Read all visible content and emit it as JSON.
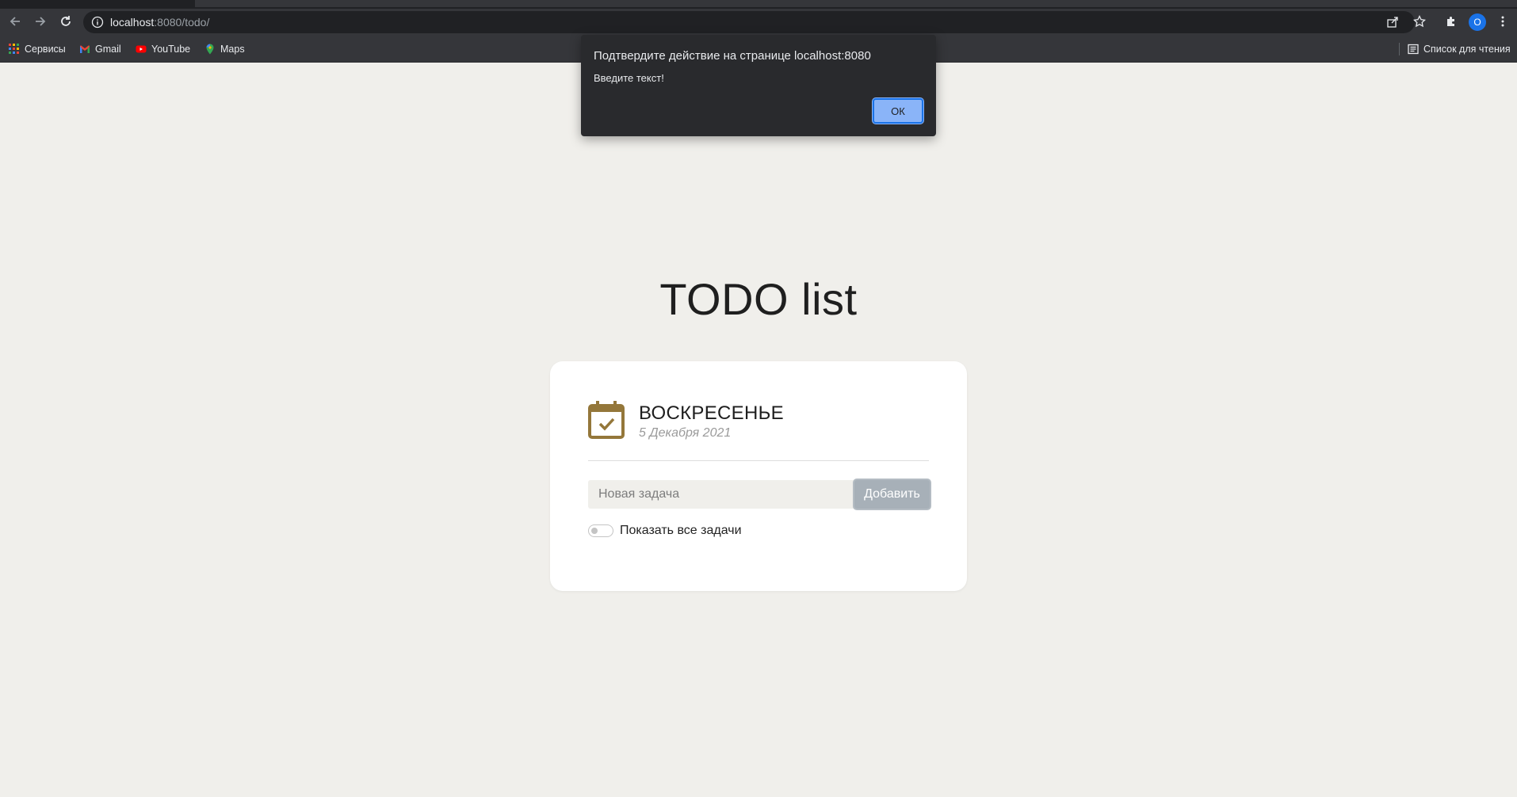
{
  "browser": {
    "url_host": "localhost",
    "url_rest": ":8080/todo/",
    "avatar_letter": "O",
    "bookmarks": [
      {
        "label": "Сервисы",
        "icon": "apps-grid-icon"
      },
      {
        "label": "Gmail",
        "icon": "gmail-icon"
      },
      {
        "label": "YouTube",
        "icon": "youtube-icon"
      },
      {
        "label": "Maps",
        "icon": "maps-pin-icon"
      }
    ],
    "reading_list": "Список для чтения"
  },
  "dialog": {
    "title": "Подтвердите действие на странице localhost:8080",
    "message": "Введите текст!",
    "ok_label": "ОК"
  },
  "page": {
    "title": "TODO list",
    "day": "ВОСКРЕСЕНЬЕ",
    "date": "5 Декабря 2021",
    "input_placeholder": "Новая задача",
    "input_value": "",
    "add_label": "Добавить",
    "toggle_label": "Показать все задачи",
    "toggle_on": false
  },
  "colors": {
    "accent_gold": "#94773a",
    "page_bg": "#f0efeb",
    "button_gray": "#a7b0b8",
    "dialog_bg": "#292a2d",
    "dialog_ok": "#8ab4f8"
  }
}
